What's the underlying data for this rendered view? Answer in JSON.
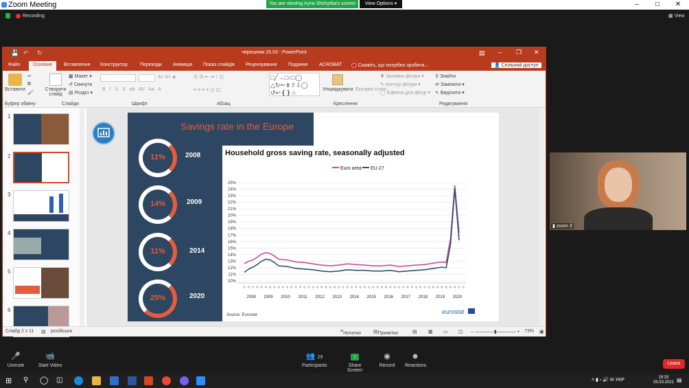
{
  "zoom": {
    "title": "Zoom Meeting",
    "banner": "You are viewing Iryna Shchyrba's screen",
    "view_options": "View Options",
    "recording": "Recording",
    "view": "View",
    "participant_label": "zoom 3",
    "toolbar": {
      "unmute": "Unmute",
      "start_video": "Start Video",
      "participants": "Participants",
      "participants_count": "29",
      "share_screen": "Share Screen",
      "record": "Record",
      "reactions": "Reactions",
      "leave": "Leave"
    }
  },
  "ppt": {
    "title": "черешнюк 25.03 - PowerPoint",
    "tabs": [
      "Файл",
      "Основне",
      "Вставлення",
      "Конструктор",
      "Переходи",
      "Анімація",
      "Показ слайдів",
      "Рецензування",
      "Подання",
      "ACROBAT"
    ],
    "tell_me": "Скажіть, що потрібно зробити...",
    "share": "Спільний доступ",
    "ribbon": {
      "paste": "Вставити",
      "new_slide": "Створити слайд",
      "layout": "Макет",
      "reset": "Скинути",
      "section": "Розділ",
      "arrange": "Упорядкувати",
      "quick_styles": "Експрес-стилі",
      "fill": "Заливка фігури",
      "outline": "Контур фігури",
      "effects": "Ефекти для фігур",
      "find": "Знайти",
      "replace": "Замінити",
      "select": "Виділити",
      "groups": [
        "Буфер обміну",
        "Слайди",
        "Шрифт",
        "Абзац",
        "Креслення",
        "Редагування"
      ]
    },
    "slide_numbers": [
      "1",
      "2",
      "3",
      "4",
      "5",
      "6"
    ],
    "status": {
      "slide": "Слайд 2 з 11",
      "lang": "російська",
      "notes": "Нотатки",
      "comments": "Примітки",
      "zoom": "73%"
    }
  },
  "slide": {
    "title": "Savings rate in the Europe",
    "items": [
      {
        "pct": "11%",
        "year": "2008",
        "value": 11
      },
      {
        "pct": "14%",
        "year": "2009",
        "value": 14
      },
      {
        "pct": "11%",
        "year": "2014",
        "value": 11
      },
      {
        "pct": "25%",
        "year": "2020",
        "value": 25
      }
    ],
    "source": "Source: Eurostat",
    "logo": "eurostat"
  },
  "colors": {
    "ppt_red": "#b83b1e",
    "euro": "#c94a9a",
    "eu27": "#2e4f6e",
    "accent": "#e65b3e"
  },
  "chart_data": {
    "type": "line",
    "title": "Household gross saving rate, seasonally adjusted",
    "xlabel": "",
    "ylabel": "",
    "ylim": [
      10,
      25
    ],
    "y_ticks": [
      "10%",
      "11%",
      "12%",
      "13%",
      "14%",
      "15%",
      "16%",
      "17%",
      "18%",
      "19%",
      "20%",
      "21%",
      "22%",
      "23%",
      "24%",
      "25%"
    ],
    "x_ticks": [
      "2008",
      "2009",
      "2010",
      "2011",
      "2012",
      "2013",
      "2014",
      "2015",
      "2016",
      "2017",
      "2018",
      "2019",
      "2020"
    ],
    "legend_position": "top-left",
    "series": [
      {
        "name": "Euro area",
        "color": "#c94a9a",
        "x": [
          2008,
          2008.25,
          2008.5,
          2008.75,
          2009,
          2009.25,
          2009.5,
          2009.75,
          2010,
          2010.5,
          2011,
          2011.5,
          2012,
          2012.5,
          2013,
          2013.5,
          2014,
          2014.5,
          2015,
          2015.5,
          2016,
          2016.5,
          2017,
          2017.5,
          2018,
          2018.5,
          2019,
          2019.5,
          2019.75,
          2020,
          2020.25,
          2020.5
        ],
        "values": [
          12.6,
          13.0,
          13.2,
          13.6,
          14.1,
          14.3,
          14.2,
          13.8,
          13.3,
          13.2,
          12.9,
          12.8,
          12.6,
          12.4,
          12.3,
          12.4,
          12.6,
          12.5,
          12.4,
          12.3,
          12.3,
          12.4,
          12.2,
          12.3,
          12.4,
          12.5,
          12.7,
          12.9,
          12.8,
          16.5,
          24.6,
          17.3
        ]
      },
      {
        "name": "EU-27",
        "color": "#2e4f6e",
        "x": [
          2008,
          2008.25,
          2008.5,
          2008.75,
          2009,
          2009.25,
          2009.5,
          2009.75,
          2010,
          2010.5,
          2011,
          2011.5,
          2012,
          2012.5,
          2013,
          2013.5,
          2014,
          2014.5,
          2015,
          2015.5,
          2016,
          2016.5,
          2017,
          2017.5,
          2018,
          2018.5,
          2019,
          2019.5,
          2019.75,
          2020,
          2020.25,
          2020.5
        ],
        "values": [
          11.3,
          11.8,
          12.1,
          12.5,
          13.0,
          13.3,
          13.2,
          12.8,
          12.3,
          12.2,
          11.9,
          11.8,
          11.7,
          11.5,
          11.4,
          11.5,
          11.7,
          11.6,
          11.6,
          11.5,
          11.5,
          11.6,
          11.4,
          11.5,
          11.6,
          11.7,
          11.9,
          12.1,
          12.0,
          15.6,
          24.1,
          16.2
        ]
      }
    ]
  }
}
